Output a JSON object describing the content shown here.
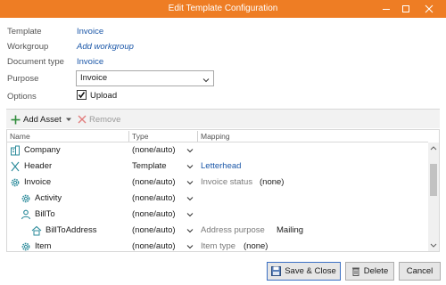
{
  "window": {
    "title": "Edit Template Configuration",
    "minimize_icon": "minimize-icon",
    "maximize_icon": "maximize-icon",
    "close_icon": "close-icon",
    "accent_color": "#ee7d24"
  },
  "form": {
    "template_label": "Template",
    "template_value": "Invoice",
    "workgroup_label": "Workgroup",
    "workgroup_value": "Add workgroup",
    "document_type_label": "Document type",
    "document_type_value": "Invoice",
    "purpose_label": "Purpose",
    "purpose_value": "Invoice",
    "options_label": "Options",
    "upload_label": "Upload",
    "upload_checked": true
  },
  "toolbar": {
    "add_asset_label": "Add Asset",
    "remove_label": "Remove"
  },
  "grid": {
    "headers": {
      "name": "Name",
      "type": "Type",
      "mapping": "Mapping"
    },
    "rows": [
      {
        "name": "Company",
        "icon": "building-icon",
        "type": "(none/auto)",
        "map_label": "",
        "map_link": "",
        "map_value": ""
      },
      {
        "name": "Header",
        "icon": "scissors-icon",
        "type": "Template",
        "map_label": "",
        "map_link": "Letterhead",
        "map_value": ""
      },
      {
        "name": "Invoice",
        "icon": "gear-icon",
        "type": "(none/auto)",
        "map_label": "Invoice status",
        "map_link": "",
        "map_value": "(none)"
      },
      {
        "name": "Activity",
        "icon": "gear-icon",
        "type": "(none/auto)",
        "map_label": "",
        "map_link": "",
        "map_value": ""
      },
      {
        "name": "BillTo",
        "icon": "person-icon",
        "type": "(none/auto)",
        "map_label": "",
        "map_link": "",
        "map_value": ""
      },
      {
        "name": "BillToAddress",
        "icon": "house-icon",
        "type": "(none/auto)",
        "map_label": "Address purpose",
        "map_link": "",
        "map_value": "Mailing"
      },
      {
        "name": "Item",
        "icon": "gear-icon",
        "type": "(none/auto)",
        "map_label": "Item type",
        "map_link": "",
        "map_value": "(none)"
      }
    ]
  },
  "buttons": {
    "save_close": "Save & Close",
    "delete": "Delete",
    "cancel": "Cancel"
  }
}
